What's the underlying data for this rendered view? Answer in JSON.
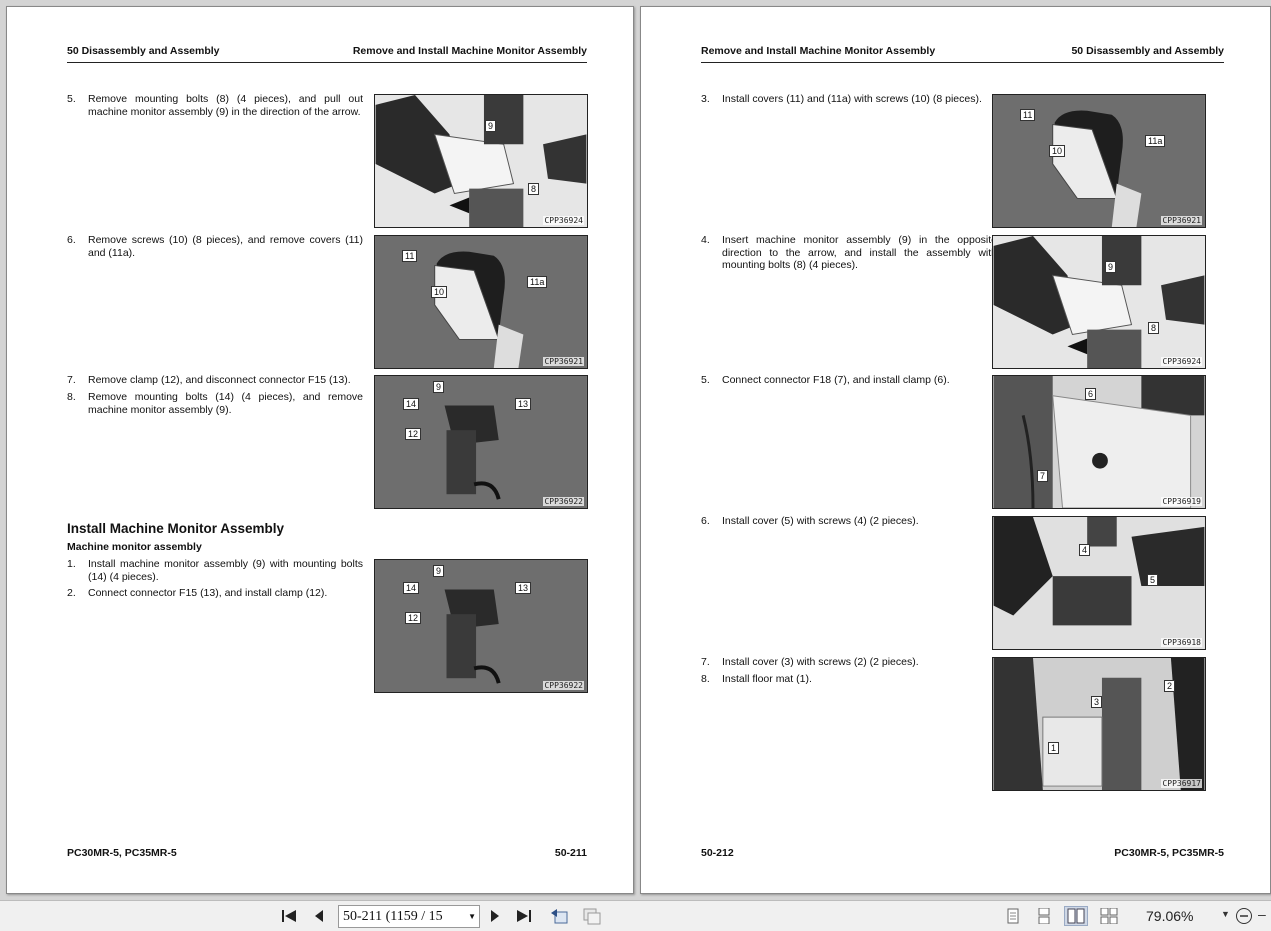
{
  "left_page": {
    "header_left": "50 Disassembly and Assembly",
    "header_right": "Remove and Install Machine Monitor Assembly",
    "steps": [
      {
        "num": "5.",
        "text": "Remove mounting bolts (8) (4 pieces), and pull out machine monitor assembly (9) in the direction of the arrow."
      },
      {
        "num": "6.",
        "text": "Remove screws (10) (8 pieces), and remove covers (11) and (11a)."
      },
      {
        "num": "7.",
        "text": "Remove clamp (12), and disconnect connector F15 (13)."
      },
      {
        "num": "8.",
        "text": "Remove mounting bolts (14) (4 pieces), and remove machine monitor assembly (9)."
      }
    ],
    "section_title": "Install Machine Monitor Assembly",
    "subsection_title": "Machine monitor assembly",
    "install_steps": [
      {
        "num": "1.",
        "text": "Install machine monitor assembly (9) with mounting bolts (14) (4 pieces)."
      },
      {
        "num": "2.",
        "text": "Connect connector F15 (13), and install clamp (12)."
      }
    ],
    "figures": [
      {
        "code": "CPP36924",
        "callouts": [
          "9",
          "8"
        ]
      },
      {
        "code": "CPP36921",
        "callouts": [
          "11",
          "11a",
          "10"
        ]
      },
      {
        "code": "CPP36922",
        "callouts": [
          "9",
          "14",
          "13",
          "12"
        ]
      },
      {
        "code": "CPP36922",
        "callouts": [
          "9",
          "14",
          "13",
          "12"
        ]
      }
    ],
    "footer_left": "PC30MR-5, PC35MR-5",
    "footer_right": "50-211"
  },
  "right_page": {
    "header_left": "Remove and Install Machine Monitor Assembly",
    "header_right": "50 Disassembly and Assembly",
    "steps": [
      {
        "num": "3.",
        "text": "Install covers (11) and (11a) with screws (10) (8 pieces)."
      },
      {
        "num": "4.",
        "text": "Insert machine monitor assembly (9) in the opposite direction to the arrow, and install the assembly with mounting bolts (8) (4 pieces)."
      },
      {
        "num": "5.",
        "text": "Connect connector F18 (7), and install clamp (6)."
      },
      {
        "num": "6.",
        "text": "Install cover (5) with screws (4) (2 pieces)."
      },
      {
        "num": "7.",
        "text": "Install cover (3) with screws (2) (2 pieces)."
      },
      {
        "num": "8.",
        "text": "Install floor mat (1)."
      }
    ],
    "figures": [
      {
        "code": "CPP36921",
        "callouts": [
          "11",
          "11a",
          "10"
        ]
      },
      {
        "code": "CPP36924",
        "callouts": [
          "9",
          "8"
        ]
      },
      {
        "code": "CPP36919",
        "callouts": [
          "6",
          "7"
        ]
      },
      {
        "code": "CPP36918",
        "callouts": [
          "4",
          "5"
        ]
      },
      {
        "code": "CPP36917",
        "callouts": [
          "3",
          "2",
          "1"
        ]
      }
    ],
    "footer_left": "50-212",
    "footer_right": "PC30MR-5, PC35MR-5"
  },
  "toolbar": {
    "page_value": "50-211 (1159 / 15",
    "zoom_value": "79.06%",
    "icons": [
      "first-page-icon",
      "prev-page-icon",
      "next-page-icon",
      "last-page-icon",
      "prev-view-icon",
      "next-view-icon",
      "single-page-icon",
      "continuous-icon",
      "facing-icon",
      "continuous-facing-icon",
      "zoom-out-icon"
    ]
  }
}
